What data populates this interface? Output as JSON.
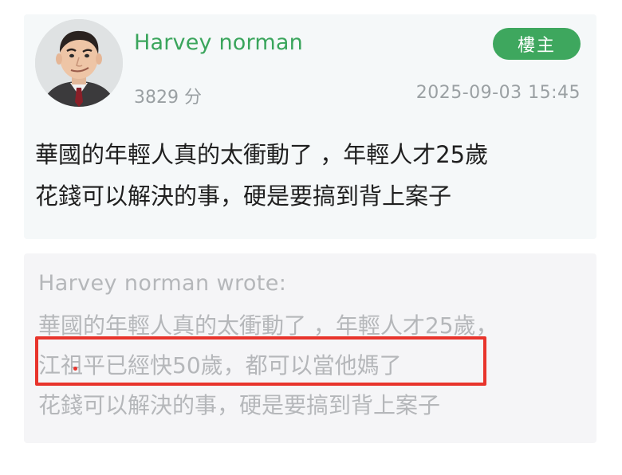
{
  "post": {
    "username": "Harvey norman",
    "badge": "樓主",
    "score": "3829 分",
    "timestamp": "2025-09-03 15:45",
    "body_lines": [
      "華國的年輕人真的太衝動了 ，年輕人才25歲",
      "花錢可以解決的事，硬是要搞到背上案子"
    ]
  },
  "quote": {
    "author_line": "Harvey norman wrote:",
    "lines": [
      "華國的年輕人真的太衝動了 ，年輕人才25歲，",
      "江祖平已經快50歲，都可以當他媽了",
      "花錢可以解決的事，硬是要搞到背上案子"
    ]
  },
  "colors": {
    "username": "#3aa55c",
    "badge_bg": "#3ea75e",
    "highlight": "#e8342c"
  },
  "icons": {
    "avatar": "user-avatar-photo"
  }
}
